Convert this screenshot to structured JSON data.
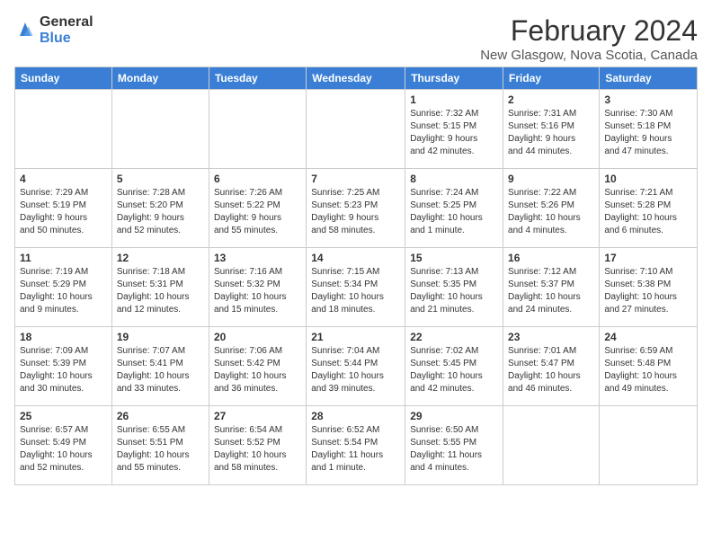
{
  "header": {
    "logo_line1": "General",
    "logo_line2": "Blue",
    "month": "February 2024",
    "location": "New Glasgow, Nova Scotia, Canada"
  },
  "days_of_week": [
    "Sunday",
    "Monday",
    "Tuesday",
    "Wednesday",
    "Thursday",
    "Friday",
    "Saturday"
  ],
  "weeks": [
    [
      {
        "date": "",
        "info": ""
      },
      {
        "date": "",
        "info": ""
      },
      {
        "date": "",
        "info": ""
      },
      {
        "date": "",
        "info": ""
      },
      {
        "date": "1",
        "info": "Sunrise: 7:32 AM\nSunset: 5:15 PM\nDaylight: 9 hours\nand 42 minutes."
      },
      {
        "date": "2",
        "info": "Sunrise: 7:31 AM\nSunset: 5:16 PM\nDaylight: 9 hours\nand 44 minutes."
      },
      {
        "date": "3",
        "info": "Sunrise: 7:30 AM\nSunset: 5:18 PM\nDaylight: 9 hours\nand 47 minutes."
      }
    ],
    [
      {
        "date": "4",
        "info": "Sunrise: 7:29 AM\nSunset: 5:19 PM\nDaylight: 9 hours\nand 50 minutes."
      },
      {
        "date": "5",
        "info": "Sunrise: 7:28 AM\nSunset: 5:20 PM\nDaylight: 9 hours\nand 52 minutes."
      },
      {
        "date": "6",
        "info": "Sunrise: 7:26 AM\nSunset: 5:22 PM\nDaylight: 9 hours\nand 55 minutes."
      },
      {
        "date": "7",
        "info": "Sunrise: 7:25 AM\nSunset: 5:23 PM\nDaylight: 9 hours\nand 58 minutes."
      },
      {
        "date": "8",
        "info": "Sunrise: 7:24 AM\nSunset: 5:25 PM\nDaylight: 10 hours\nand 1 minute."
      },
      {
        "date": "9",
        "info": "Sunrise: 7:22 AM\nSunset: 5:26 PM\nDaylight: 10 hours\nand 4 minutes."
      },
      {
        "date": "10",
        "info": "Sunrise: 7:21 AM\nSunset: 5:28 PM\nDaylight: 10 hours\nand 6 minutes."
      }
    ],
    [
      {
        "date": "11",
        "info": "Sunrise: 7:19 AM\nSunset: 5:29 PM\nDaylight: 10 hours\nand 9 minutes."
      },
      {
        "date": "12",
        "info": "Sunrise: 7:18 AM\nSunset: 5:31 PM\nDaylight: 10 hours\nand 12 minutes."
      },
      {
        "date": "13",
        "info": "Sunrise: 7:16 AM\nSunset: 5:32 PM\nDaylight: 10 hours\nand 15 minutes."
      },
      {
        "date": "14",
        "info": "Sunrise: 7:15 AM\nSunset: 5:34 PM\nDaylight: 10 hours\nand 18 minutes."
      },
      {
        "date": "15",
        "info": "Sunrise: 7:13 AM\nSunset: 5:35 PM\nDaylight: 10 hours\nand 21 minutes."
      },
      {
        "date": "16",
        "info": "Sunrise: 7:12 AM\nSunset: 5:37 PM\nDaylight: 10 hours\nand 24 minutes."
      },
      {
        "date": "17",
        "info": "Sunrise: 7:10 AM\nSunset: 5:38 PM\nDaylight: 10 hours\nand 27 minutes."
      }
    ],
    [
      {
        "date": "18",
        "info": "Sunrise: 7:09 AM\nSunset: 5:39 PM\nDaylight: 10 hours\nand 30 minutes."
      },
      {
        "date": "19",
        "info": "Sunrise: 7:07 AM\nSunset: 5:41 PM\nDaylight: 10 hours\nand 33 minutes."
      },
      {
        "date": "20",
        "info": "Sunrise: 7:06 AM\nSunset: 5:42 PM\nDaylight: 10 hours\nand 36 minutes."
      },
      {
        "date": "21",
        "info": "Sunrise: 7:04 AM\nSunset: 5:44 PM\nDaylight: 10 hours\nand 39 minutes."
      },
      {
        "date": "22",
        "info": "Sunrise: 7:02 AM\nSunset: 5:45 PM\nDaylight: 10 hours\nand 42 minutes."
      },
      {
        "date": "23",
        "info": "Sunrise: 7:01 AM\nSunset: 5:47 PM\nDaylight: 10 hours\nand 46 minutes."
      },
      {
        "date": "24",
        "info": "Sunrise: 6:59 AM\nSunset: 5:48 PM\nDaylight: 10 hours\nand 49 minutes."
      }
    ],
    [
      {
        "date": "25",
        "info": "Sunrise: 6:57 AM\nSunset: 5:49 PM\nDaylight: 10 hours\nand 52 minutes."
      },
      {
        "date": "26",
        "info": "Sunrise: 6:55 AM\nSunset: 5:51 PM\nDaylight: 10 hours\nand 55 minutes."
      },
      {
        "date": "27",
        "info": "Sunrise: 6:54 AM\nSunset: 5:52 PM\nDaylight: 10 hours\nand 58 minutes."
      },
      {
        "date": "28",
        "info": "Sunrise: 6:52 AM\nSunset: 5:54 PM\nDaylight: 11 hours\nand 1 minute."
      },
      {
        "date": "29",
        "info": "Sunrise: 6:50 AM\nSunset: 5:55 PM\nDaylight: 11 hours\nand 4 minutes."
      },
      {
        "date": "",
        "info": ""
      },
      {
        "date": "",
        "info": ""
      }
    ]
  ]
}
